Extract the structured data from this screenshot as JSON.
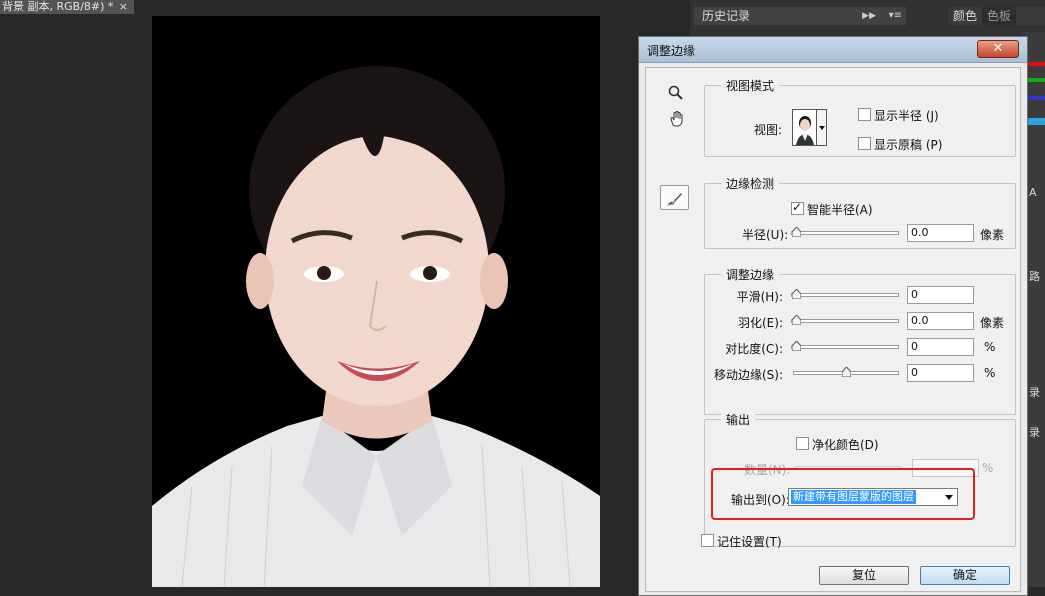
{
  "document": {
    "tab_title": "背景 副本, RGB/8#) *",
    "close_glyph": "×"
  },
  "right_panel": {
    "history_tab": "历史记录",
    "color_tabs": [
      "颜色",
      "色板"
    ],
    "strip_glyphs": [
      "A",
      "路",
      "录",
      "录"
    ],
    "swatch_colors": [
      "#d11",
      "#1a1",
      "#33c",
      "#29a6d9"
    ]
  },
  "dialog": {
    "title": "调整边缘",
    "close_glyph": "✕",
    "view_mode": {
      "legend": "视图模式",
      "view_label": "视图:",
      "show_radius": "显示半径 (J)",
      "show_original": "显示原稿 (P)"
    },
    "edge_detection": {
      "legend": "边缘检测",
      "smart_radius": "智能半径(A)",
      "smart_radius_checked": true,
      "radius_label": "半径(U):",
      "radius_value": "0.0",
      "radius_unit": "像素",
      "radius_level": 0
    },
    "adjust_edge": {
      "legend": "调整边缘",
      "rows": [
        {
          "label": "平滑(H):",
          "value": "0",
          "unit": "",
          "level": 0
        },
        {
          "label": "羽化(E):",
          "value": "0.0",
          "unit": "像素",
          "level": 0
        },
        {
          "label": "对比度(C):",
          "value": "0",
          "unit": "%",
          "level": 0
        },
        {
          "label": "移动边缘(S):",
          "value": "0",
          "unit": "%",
          "level": 0.5
        }
      ]
    },
    "output": {
      "legend": "输出",
      "decontaminate": "净化颜色(D)",
      "amount_label": "数量(N):",
      "amount_unit": "%",
      "output_to_label": "输出到(O):",
      "output_to_value": "新建带有图层蒙版的图层"
    },
    "remember": "记住设置(T)",
    "reset": "复位",
    "ok": "确定"
  }
}
